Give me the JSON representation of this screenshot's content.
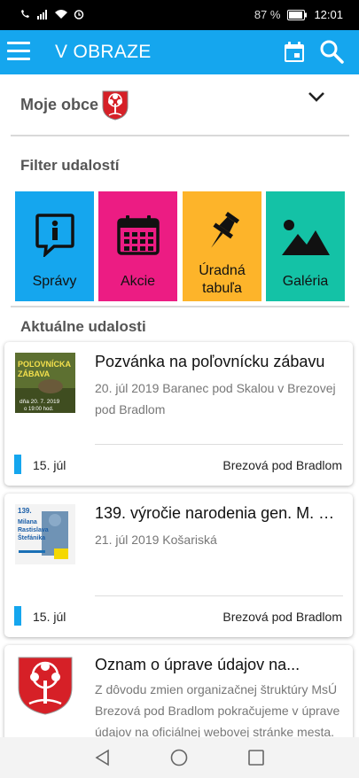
{
  "status": {
    "battery": "87 %",
    "time": "12:01"
  },
  "appbar": {
    "title": "V OBRAZE"
  },
  "moje": {
    "label": "Moje obce"
  },
  "filter": {
    "title": "Filter udalostí",
    "tiles": [
      {
        "label": "Správy",
        "color": "#15a6ee",
        "icon": "info-icon"
      },
      {
        "label": "Akcie",
        "color": "#ec1c83",
        "icon": "calendar-grid-icon"
      },
      {
        "label": "Úradná tabuľa",
        "line1": "Úradná",
        "line2": "tabuľa",
        "color": "#fdb42a",
        "icon": "pushpin-icon"
      },
      {
        "label": "Galéria",
        "color": "#14c2a6",
        "icon": "image-icon"
      }
    ]
  },
  "events": {
    "title": "Aktuálne udalosti",
    "items": [
      {
        "title": "Pozvánka na poľovnícku zábavu",
        "subtitle": "20. júl 2019 Baranec pod Skalou v Brezovej pod Bradlom",
        "date": "15. júl",
        "location": "Brezová pod Bradlom",
        "thumb": {
          "line1": "POĽOVNÍCKA",
          "line2": "ZÁBAVA",
          "line3": "dňa 20. 7. 2019",
          "line4": "o 19:00 hod."
        }
      },
      {
        "title": "139. výročie narodenia gen. M. R....",
        "subtitle": "21. júl 2019 Košariská",
        "date": "15. júl",
        "location": "Brezová pod Bradlom",
        "thumb": {
          "line1": "139.",
          "line2": "Milana",
          "line3": "Rastislava",
          "line4": "Štefánika"
        }
      },
      {
        "title": "Oznam o úprave údajov na...",
        "description": "Z dôvodu zmien organizačnej štruktúry MsÚ Brezová pod Bradlom pokračujeme v úprave údajov na oficiálnej webovej stránke mesta. ..."
      }
    ]
  },
  "colors": {
    "accent": "#15a6ee",
    "bar": "#15a6ee"
  }
}
